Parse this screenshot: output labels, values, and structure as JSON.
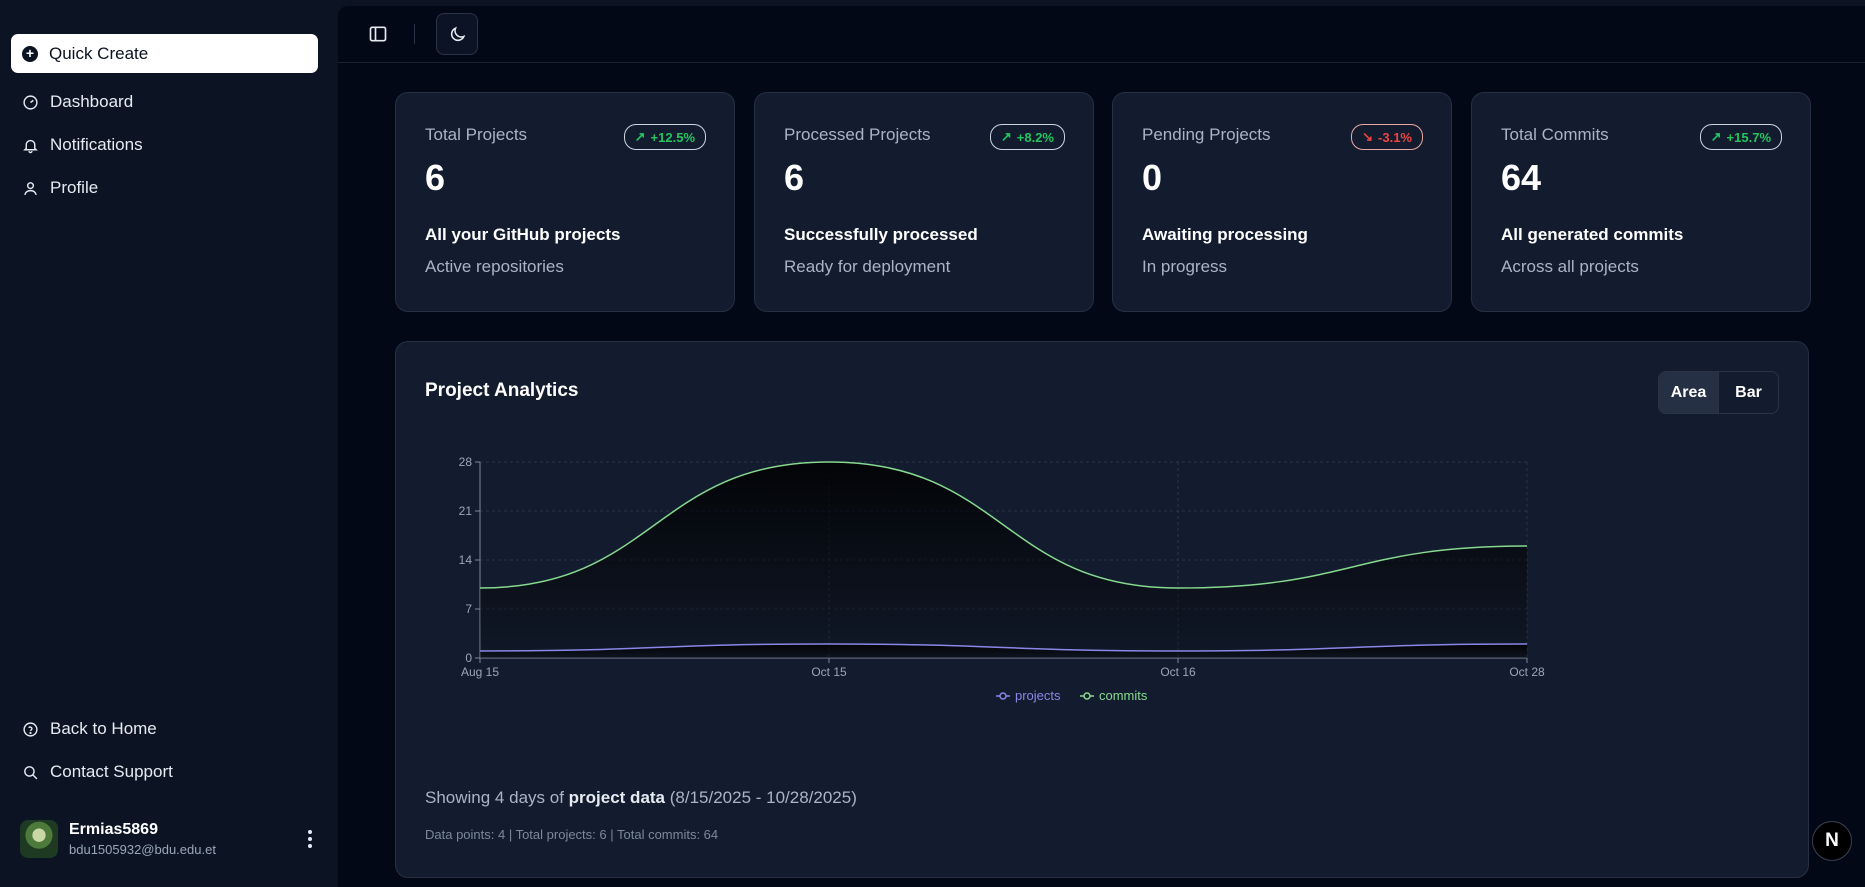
{
  "sidebar": {
    "quick_create": "Quick Create",
    "nav": [
      {
        "label": "Dashboard",
        "icon": "gauge-icon"
      },
      {
        "label": "Notifications",
        "icon": "bell-icon"
      },
      {
        "label": "Profile",
        "icon": "user-icon"
      }
    ],
    "bottom": [
      {
        "label": "Back to Home",
        "icon": "help-circle-icon"
      },
      {
        "label": "Contact Support",
        "icon": "search-icon"
      }
    ],
    "user": {
      "name": "Ermias5869",
      "email": "bdu1505932@bdu.edu.et"
    }
  },
  "cards": [
    {
      "title": "Total Projects",
      "badge": "+12.5%",
      "trend": "up",
      "value": "6",
      "sub1": "All your GitHub projects",
      "sub2": "Active repositories"
    },
    {
      "title": "Processed Projects",
      "badge": "+8.2%",
      "trend": "up",
      "value": "6",
      "sub1": "Successfully processed",
      "sub2": "Ready for deployment"
    },
    {
      "title": "Pending Projects",
      "badge": "-3.1%",
      "trend": "down",
      "value": "0",
      "sub1": "Awaiting processing",
      "sub2": "In progress"
    },
    {
      "title": "Total Commits",
      "badge": "+15.7%",
      "trend": "up",
      "value": "64",
      "sub1": "All generated commits",
      "sub2": "Across all projects"
    }
  ],
  "analytics": {
    "title": "Project Analytics",
    "toggle": [
      "Area",
      "Bar"
    ],
    "footer_prefix": "Showing 4 days of ",
    "footer_bold": "project data",
    "footer_range": " (8/15/2025 - 10/28/2025)",
    "footer_stats": "Data points: 4 | Total projects: 6 | Total commits: 64"
  },
  "chart_data": {
    "type": "area",
    "categories": [
      "Aug 15",
      "Oct 15",
      "Oct 16",
      "Oct 28"
    ],
    "yticks": [
      0,
      7,
      14,
      21,
      28
    ],
    "ylim": [
      0,
      28
    ],
    "series": [
      {
        "name": "projects",
        "values": [
          1,
          2,
          1,
          2
        ],
        "color": "#8b87e8"
      },
      {
        "name": "commits",
        "values": [
          10,
          28,
          10,
          16
        ],
        "color": "#86d98f"
      }
    ],
    "legend": "bottom"
  },
  "colors": {
    "accent_up": "#22c55e",
    "accent_down": "#ef4444"
  },
  "fab": {
    "label": "N"
  }
}
